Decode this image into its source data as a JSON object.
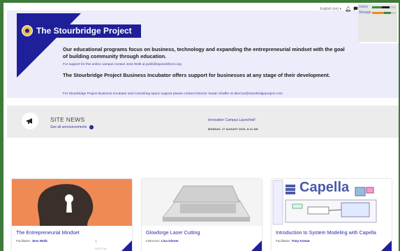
{
  "header": {
    "language": "English (en)",
    "language_caret": "▾",
    "bell_icon": "bell-icon",
    "chat_icon": "chat-icon",
    "usage": {
      "users_label": "Users",
      "storage_label": "Storage",
      "users_colors": [
        "#3a8a3a",
        "#1a1a1a"
      ],
      "storage_colors": [
        "#f08a1a",
        "#3a8a3a"
      ]
    }
  },
  "hero": {
    "logo_text": "The Stourbridge Project",
    "mission": "Our educational programs focus on business, technology and expanding the entrepreneurial mindset with the goal of building community through education.",
    "support_campus": "For support for this online campus contact Jess Wolk at jwolk@wpworkforce.org",
    "incubator": "The Stourbridge Project Business Incubator offers support for businesses at any stage of their development.",
    "support_incubator": "For Stourbridge Project Business Incubator and Coworking space support please contact Director Susan Shaffer at director@stourbridgeproject.com"
  },
  "news": {
    "title": "SITE NEWS",
    "see_all": "See all announcements",
    "announcement_title": "Innovation Campus Launched!",
    "announcement_date": "MONDAY, 17 AUGUST 2020, 8:21 AM"
  },
  "courses": [
    {
      "title": "The Entrepreneurial Mindset",
      "role": "Facilitator",
      "person": "Jess Wolk",
      "tag": "1",
      "tag2": "FACETIAL",
      "image_colors": [
        "#f08a55",
        "#333333"
      ]
    },
    {
      "title": "Glowforge Laser Cutting",
      "role": "Instructor",
      "person": "Lisa Glover",
      "image_colors": [
        "#f5f5f5",
        "#c8c8c8"
      ]
    },
    {
      "title": "Introduction to System Modeling with Capella",
      "role": "Facilitator",
      "person": "Tony Komar",
      "image_text": "Capella",
      "image_colors": [
        "#4a5aa8",
        "#ffffff"
      ]
    }
  ]
}
